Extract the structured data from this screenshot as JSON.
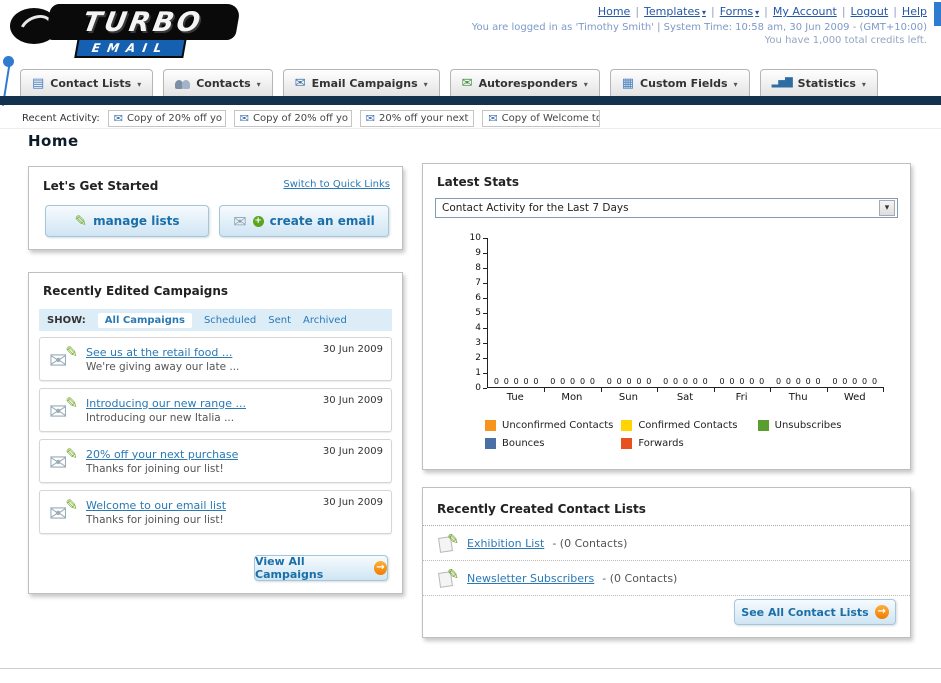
{
  "header": {
    "logo": {
      "line1": "TURBO",
      "line2": "EMAIL"
    },
    "nav": {
      "home": "Home",
      "templates": "Templates",
      "forms": "Forms",
      "my_account": "My Account",
      "logout": "Logout",
      "help": "Help"
    },
    "login_info": "You are logged in as 'Timothy Smith' | System Time: 10:58 am, 30 Jun 2009 - (GMT+10:00)",
    "credits_info": "You have 1,000 total credits left."
  },
  "main_nav": {
    "tabs": [
      {
        "label": "Contact Lists"
      },
      {
        "label": "Contacts"
      },
      {
        "label": "Email Campaigns"
      },
      {
        "label": "Autoresponders"
      },
      {
        "label": "Custom Fields"
      },
      {
        "label": "Statistics"
      }
    ]
  },
  "recent_activity": {
    "label": "Recent Activity:",
    "items": [
      "Copy of 20% off yo",
      "Copy of 20% off yo",
      "20% off your next",
      "Copy of Welcome to"
    ]
  },
  "page_title": "Home",
  "get_started": {
    "title": "Let's Get Started",
    "switch_link": "Switch to Quick Links",
    "manage_lists": "manage lists",
    "create_email": "create an email"
  },
  "campaigns": {
    "title": "Recently Edited Campaigns",
    "show_label": "SHOW:",
    "tabs": [
      "All Campaigns",
      "Scheduled",
      "Sent",
      "Archived"
    ],
    "active_tab": "All Campaigns",
    "items": [
      {
        "title": "See us at the retail food ...",
        "subtitle": "We're giving away our late ...",
        "date": "30 Jun 2009"
      },
      {
        "title": "Introducing our new range ...",
        "subtitle": "Introducing our new Italia ...",
        "date": "30 Jun 2009"
      },
      {
        "title": "20% off your next purchase",
        "subtitle": "Thanks for joining our list!",
        "date": "30 Jun 2009"
      },
      {
        "title": "Welcome to our email list",
        "subtitle": "Thanks for joining our list!",
        "date": "30 Jun 2009"
      }
    ],
    "view_all": "View All Campaigns"
  },
  "stats": {
    "title": "Latest Stats",
    "period_selector": "Contact Activity for the Last 7 Days",
    "chart_data": {
      "type": "bar",
      "title": "Contact Activity for the Last 7 Days",
      "categories": [
        "Tue",
        "Mon",
        "Sun",
        "Sat",
        "Fri",
        "Thu",
        "Wed"
      ],
      "series": [
        {
          "name": "Unconfirmed Contacts",
          "color": "#f7941d",
          "values": [
            0,
            0,
            0,
            0,
            0,
            0,
            0
          ]
        },
        {
          "name": "Confirmed Contacts",
          "color": "#ffd400",
          "values": [
            0,
            0,
            0,
            0,
            0,
            0,
            0
          ]
        },
        {
          "name": "Unsubscribes",
          "color": "#5a9e2f",
          "values": [
            0,
            0,
            0,
            0,
            0,
            0,
            0
          ]
        },
        {
          "name": "Bounces",
          "color": "#4a6fa5",
          "values": [
            0,
            0,
            0,
            0,
            0,
            0,
            0
          ]
        },
        {
          "name": "Forwards",
          "color": "#e8501d",
          "values": [
            0,
            0,
            0,
            0,
            0,
            0,
            0
          ]
        }
      ],
      "ylim": [
        0,
        10
      ],
      "ytick_step": 1,
      "grid": false,
      "value_labels": true,
      "legend_position": "bottom"
    }
  },
  "contact_lists": {
    "title": "Recently Created Contact Lists",
    "items": [
      {
        "name": "Exhibition List",
        "detail": "- (0 Contacts)"
      },
      {
        "name": "Newsletter Subscribers",
        "detail": "- (0 Contacts)"
      }
    ],
    "see_all": "See All Contact Lists"
  },
  "colors": {
    "accent_blue": "#2a79b5",
    "navy_bar": "#14324d",
    "link_blue": "#2458a6",
    "button_text_blue": "#1b6fa8",
    "orange_badge": "#f07c00"
  }
}
